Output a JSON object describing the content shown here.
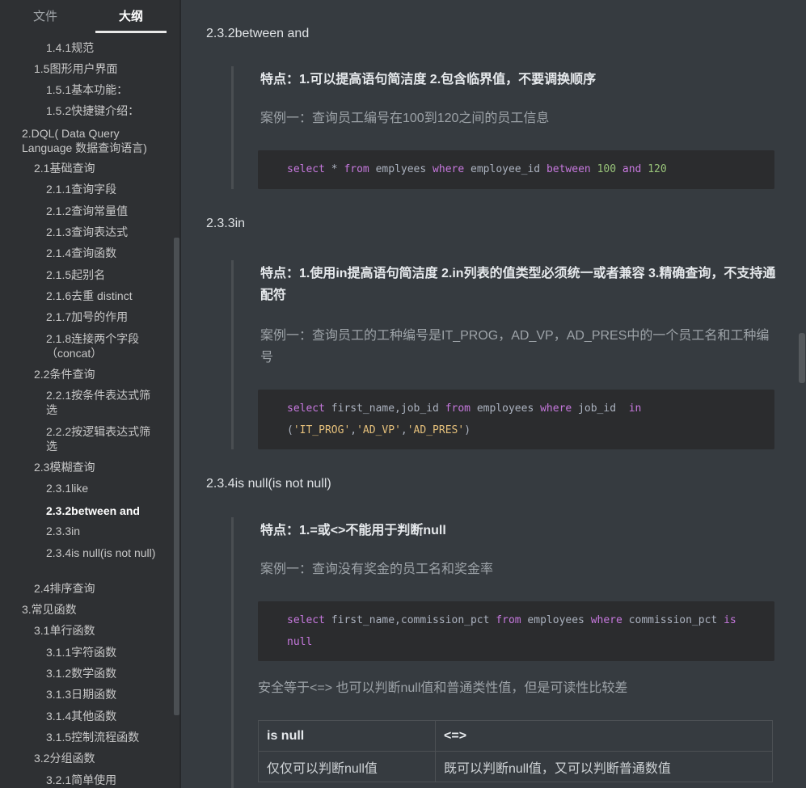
{
  "sidebar": {
    "tabs": {
      "files": "文件",
      "outline": "大纲"
    },
    "outline": [
      {
        "label": "1.4.1规范"
      },
      {
        "label": "1.5图形用户界面"
      },
      {
        "label": "1.5.1基本功能："
      },
      {
        "label": "1.5.2快捷键介绍："
      },
      {
        "label": "2.DQL( Data Query Language 数据查询语言)"
      },
      {
        "label": "2.1基础查询"
      },
      {
        "label": "2.1.1查询字段"
      },
      {
        "label": "2.1.2查询常量值"
      },
      {
        "label": "2.1.3查询表达式"
      },
      {
        "label": "2.1.4查询函数"
      },
      {
        "label": "2.1.5起别名"
      },
      {
        "label": "2.1.6去重 distinct"
      },
      {
        "label": "2.1.7加号的作用"
      },
      {
        "label": "2.1.8连接两个字段（concat）"
      },
      {
        "label": "2.2条件查询"
      },
      {
        "label": "2.2.1按条件表达式筛选"
      },
      {
        "label": "2.2.2按逻辑表达式筛选"
      },
      {
        "label": "2.3模糊查询"
      },
      {
        "label": "2.3.1like"
      },
      {
        "label": "2.3.2between and",
        "active": true
      },
      {
        "label": "2.3.3in"
      },
      {
        "label": "2.3.4is null(is not null)"
      },
      {
        "label": "2.4排序查询"
      },
      {
        "label": "3.常见函数"
      },
      {
        "label": "3.1单行函数"
      },
      {
        "label": "3.1.1字符函数"
      },
      {
        "label": "3.1.2数学函数"
      },
      {
        "label": "3.1.3日期函数"
      },
      {
        "label": "3.1.4其他函数"
      },
      {
        "label": "3.1.5控制流程函数"
      },
      {
        "label": "3.2分组函数"
      },
      {
        "label": "3.2.1简单使用"
      }
    ]
  },
  "content": {
    "s1": {
      "heading": "2.3.2between and",
      "feature": "特点：1.可以提高语句简洁度 2.包含临界值，不要调换顺序",
      "case": "案例一：查询员工编号在100到120之间的员工信息",
      "code": [
        [
          {
            "t": "select",
            "c": "kw"
          },
          {
            "t": " * ",
            "c": "plain"
          },
          {
            "t": "from",
            "c": "kw"
          },
          {
            "t": " emplyees ",
            "c": "plain"
          },
          {
            "t": "where",
            "c": "kw"
          },
          {
            "t": " employee_id ",
            "c": "plain"
          },
          {
            "t": "between",
            "c": "kw"
          },
          {
            "t": " ",
            "c": "plain"
          },
          {
            "t": "100",
            "c": "num"
          },
          {
            "t": " ",
            "c": "plain"
          },
          {
            "t": "and",
            "c": "kw"
          },
          {
            "t": " ",
            "c": "plain"
          },
          {
            "t": "120",
            "c": "num"
          }
        ]
      ]
    },
    "s2": {
      "heading": "2.3.3in",
      "feature": "特点：1.使用in提高语句简洁度 2.in列表的值类型必须统一或者兼容 3.精确查询，不支持通配符",
      "case": "案例一：查询员工的工种编号是IT_PROG，AD_VP，AD_PRES中的一个员工名和工种编号",
      "code": [
        [
          {
            "t": "select",
            "c": "kw"
          },
          {
            "t": " first_name,job_id ",
            "c": "plain"
          },
          {
            "t": "from",
            "c": "kw"
          },
          {
            "t": " employees ",
            "c": "plain"
          },
          {
            "t": "where",
            "c": "kw"
          },
          {
            "t": " job_id  ",
            "c": "plain"
          },
          {
            "t": "in",
            "c": "kw"
          }
        ],
        [
          {
            "t": "(",
            "c": "plain"
          },
          {
            "t": "'IT_PROG'",
            "c": "str"
          },
          {
            "t": ",",
            "c": "plain"
          },
          {
            "t": "'AD_VP'",
            "c": "str"
          },
          {
            "t": ",",
            "c": "plain"
          },
          {
            "t": "'AD_PRES'",
            "c": "str"
          },
          {
            "t": ")",
            "c": "plain"
          }
        ]
      ]
    },
    "s3": {
      "heading": "2.3.4is null(is not null)",
      "feature": "特点：1.=或<>不能用于判断null",
      "case": "案例一：查询没有奖金的员工名和奖金率",
      "code": [
        [
          {
            "t": "select",
            "c": "kw"
          },
          {
            "t": " first_name,commission_pct ",
            "c": "plain"
          },
          {
            "t": "from",
            "c": "kw"
          },
          {
            "t": " employees ",
            "c": "plain"
          },
          {
            "t": "where",
            "c": "kw"
          },
          {
            "t": " commission_pct ",
            "c": "plain"
          },
          {
            "t": "is",
            "c": "kw"
          }
        ],
        [
          {
            "t": "null",
            "c": "kw"
          }
        ]
      ],
      "safe_equal_text": "安全等于<=> 也可以判断null值和普通类性值，但是可读性比较差",
      "table": {
        "headers": [
          "is null",
          "<=>"
        ],
        "rows": [
          [
            "仅仅可以判断null值",
            "既可以判断null值，又可以判断普通数值"
          ]
        ]
      }
    }
  }
}
